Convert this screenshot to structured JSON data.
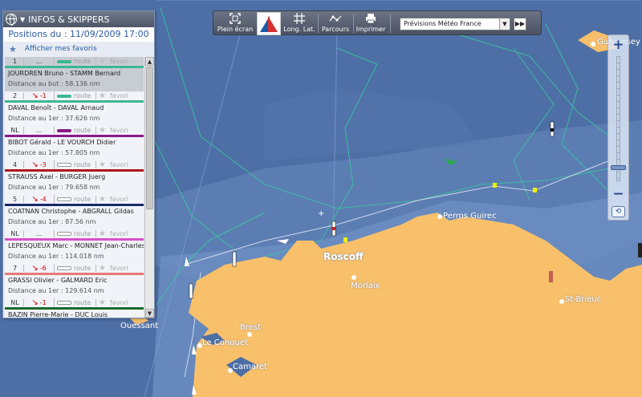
{
  "panel": {
    "title": "INFOS & SKIPPERS",
    "positions_label": "Positions du : 11/09/2009 17:00",
    "favorites_link": "Afficher mes favoris",
    "entries": [
      {
        "rank": "1",
        "trend": "...",
        "trend_dir": "",
        "route_label": "route",
        "route_color": "#3cb890",
        "fav_label": "favori",
        "name": "JOURDREN Bruno - STAMM Bernard",
        "distance": "Distance au but : 58.136 nm",
        "underline": "#3cb890",
        "selected": true
      },
      {
        "rank": "2",
        "trend": "-1",
        "trend_dir": "down",
        "route_label": "route",
        "route_color": "#3cb890",
        "fav_label": "favori",
        "name": "DAVAL Benoît - DAVAL Arnaud",
        "distance": "Distance au 1er : 37.626 nm",
        "underline": "#3cb890",
        "selected": false
      },
      {
        "rank": "NL",
        "trend": "...",
        "trend_dir": "",
        "route_label": "route",
        "route_color": "#8a1a8a",
        "fav_label": "favori",
        "name": "BIBOT Gérald - LE VOURCH Didier",
        "distance": "Distance au 1er : 57.805 nm",
        "underline": "#8a1a8a",
        "selected": false
      },
      {
        "rank": "4",
        "trend": "-3",
        "trend_dir": "down",
        "route_label": "route",
        "route_color": "",
        "fav_label": "favori",
        "name": "STRAUSS Axel - BURGER Juerg",
        "distance": "Distance au 1er : 79.658 nm",
        "underline": "#b01818",
        "selected": false
      },
      {
        "rank": "5",
        "trend": "-4",
        "trend_dir": "down",
        "route_label": "route",
        "route_color": "",
        "fav_label": "favori",
        "name": "COATNAN Christophe - ABGRALL Gildas",
        "distance": "Distance au 1er : 87.56 nm",
        "underline": "#1a2a6a",
        "selected": false
      },
      {
        "rank": "NL",
        "trend": "...",
        "trend_dir": "",
        "route_label": "route",
        "route_color": "",
        "fav_label": "favori",
        "name": "LEPESQUEUX Marc - MONNET Jean-Charles",
        "distance": "Distance au 1er : 114.018 nm",
        "underline": "#d850c8",
        "selected": false
      },
      {
        "rank": "7",
        "trend": "-6",
        "trend_dir": "down",
        "route_label": "route",
        "route_color": "",
        "fav_label": "favori",
        "name": "GRASSI Olivier - GALMARD Eric",
        "distance": "Distance au 1er : 129.614 nm",
        "underline": "#e87878",
        "selected": false
      },
      {
        "rank": "NL",
        "trend": "-1",
        "trend_dir": "down",
        "route_label": "route",
        "route_color": "",
        "fav_label": "favori",
        "name": "BAZIN Pierre-Marie - DUC Louis",
        "distance": "",
        "underline": "#1a6a2a",
        "selected": false
      }
    ]
  },
  "toolbar": {
    "fullscreen_label": "Plein écran",
    "longlat_label": "Long. Lat.",
    "parcours_label": "Parcours",
    "print_label": "Imprimer",
    "forecast_select": "Prévisions Météo France",
    "forward_label": "▶▶"
  },
  "zoom": {
    "plus": "+",
    "minus": "−",
    "reset": "⟲"
  },
  "map": {
    "places": {
      "roscoff": "Roscoff",
      "perros": "Perros Guirec",
      "morlaix": "Morlaix",
      "stbrieuc": "St-Brieuc",
      "ouessant": "Ouessant",
      "brest": "Brest",
      "conquet": "Le Conquet",
      "camaret": "Camaret",
      "guernesey": "Guernesey"
    },
    "colors": {
      "sea": "#4d6fa6",
      "land": "#f8c06a",
      "shallow": "#6a8bbf"
    }
  }
}
